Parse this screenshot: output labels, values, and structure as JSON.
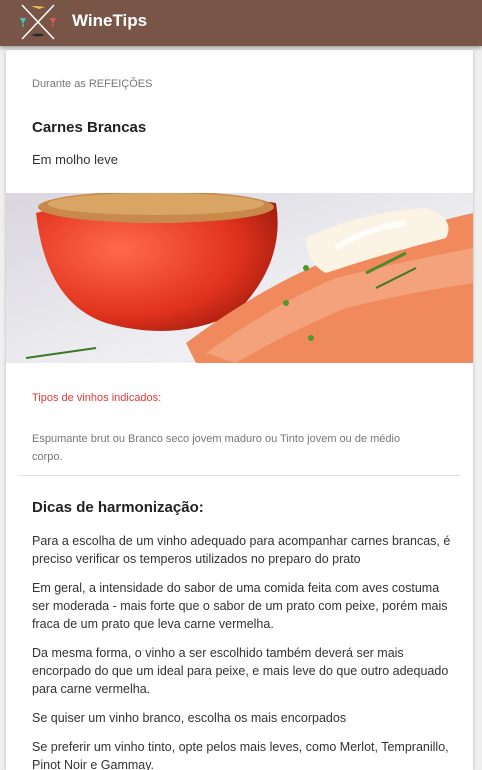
{
  "app": {
    "title": "WineTips",
    "bar_color": "#795548",
    "logo_icon": "crossed-wine-glasses-icon"
  },
  "card": {
    "subhead": "Durante as REFEIÇÕES",
    "title": "Carnes Brancas",
    "subtitle": "Em molho leve",
    "image_icon": "food-photo-tomato-salmon",
    "types_label": "Tipos de vinhos indicados:",
    "types_label_color": "#e53935",
    "types_text": "Espumante brut ou Branco seco jovem maduro ou Tinto jovem ou de médio corpo.",
    "tips_title": "Dicas de harmonização:",
    "tips": [
      "Para a escolha de um vinho adequado para acompanhar carnes brancas, é preciso verificar os temperos utilizados no preparo do prato",
      "Em geral, a intensidade do sabor de uma comida feita com aves costuma ser moderada - mais forte que o sabor de um prato com peixe, porém mais fraca de um prato que leva carne vermelha.",
      "Da mesma forma, o vinho a ser escolhido também deverá ser mais encorpado do que um ideal para peixe, e mais leve do que outro adequado para carne vermelha.",
      "Se quiser um vinho branco, escolha os mais encorpados",
      "Se preferir um vinho tinto, opte pelos mais leves, como Merlot, Tempranillo, Pinot Noir e Gammay."
    ]
  }
}
